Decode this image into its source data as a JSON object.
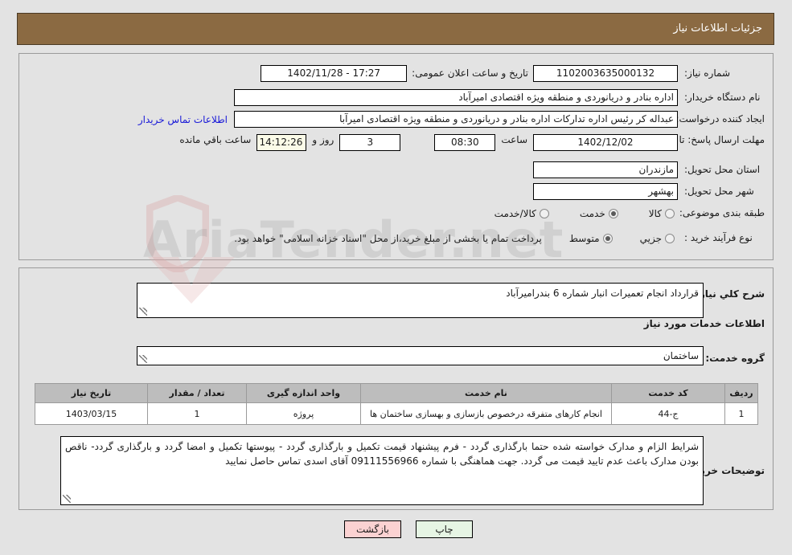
{
  "header": {
    "title": "جزئیات اطلاعات نیاز"
  },
  "top": {
    "need_number_label": "شماره نیاز:",
    "need_number_value": "1102003635000132",
    "announce_label": "تاریخ و ساعت اعلان عمومی:",
    "announce_value": "17:27 - 1402/11/28",
    "buyer_org_label": "نام دستگاه خریدار:",
    "buyer_org_value": "اداره بنادر و دریانوردی و منطقه ویژه اقتصادی امیرآباد",
    "requester_label": "ایجاد کننده درخواست:",
    "requester_value": "عبداله کر رئیس اداره تدارکات اداره بنادر و دریانوردی و منطقه ویژه اقتصادی امیرآبا",
    "contact_link": "اطلاعات تماس خریدار",
    "deadline_label": "مهلت ارسال پاسخ: تا تاریخ:",
    "deadline_date": "1402/12/02",
    "time_label": "ساعت",
    "deadline_time": "08:30",
    "days_value": "3",
    "days_label": "روز و",
    "countdown_value": "14:12:26",
    "countdown_label": "ساعت باقي مانده",
    "province_label": "استان محل تحویل:",
    "province_value": "مازندران",
    "city_label": "شهر محل تحویل:",
    "city_value": "بهشهر",
    "category_label": "طبقه بندی موضوعی:",
    "category_options": [
      {
        "label": "کالا",
        "selected": false
      },
      {
        "label": "خدمت",
        "selected": true
      },
      {
        "label": "کالا/خدمت",
        "selected": false
      }
    ],
    "process_label": "نوع فرآیند خرید :",
    "process_options": [
      {
        "label": "جزیي",
        "selected": false
      },
      {
        "label": "متوسط",
        "selected": true
      }
    ],
    "process_note": "پرداخت تمام یا بخشی از مبلغ خرید،از محل \"اسناد خزانه اسلامی\" خواهد بود."
  },
  "middle": {
    "general_desc_label": "شرح کلي نیاز:",
    "general_desc_value": "قرارداد انجام تعمیرات انبار شماره 6 بندرامیرآباد",
    "services_info_label": "اطلاعات خدمات مورد نیاز",
    "service_group_label": "گروه خدمت:",
    "service_group_value": "ساختمان",
    "buyer_notes_label": "توضیحات خریدار:",
    "buyer_notes_value": "شرایط الزام و مدارک خواسته شده حتما بارگذاری گردد - فرم پیشنهاد قیمت تکمیل و بارگذاری گردد - پیوستها تکمیل و امضا گردد و بارگذاری گردد- ناقص بودن مدارک باعث عدم تایید قیمت می گردد. جهت هماهنگی با شماره 09111556966 آقای اسدی تماس حاصل نمایید"
  },
  "table": {
    "columns": [
      "ردیف",
      "کد خدمت",
      "نام خدمت",
      "واحد اندازه گیری",
      "تعداد / مقدار",
      "تاریخ نیاز"
    ],
    "rows": [
      {
        "row_no": "1",
        "service_code": "ج-44",
        "service_name": "انجام کارهای متفرقه درخصوص بازسازی و بهسازی ساختمان ها",
        "unit": "پروژه",
        "quantity": "1",
        "need_date": "1403/03/15"
      }
    ]
  },
  "footer": {
    "back_label": "بازگشت",
    "print_label": "چاپ"
  },
  "watermark": {
    "text": "AriaTender.net",
    "shield_icon": "shield-icon",
    "arrow_icon": "arrow-down-icon"
  },
  "colors": {
    "header_bg": "#8b6a42",
    "page_bg": "#e3e3e3",
    "link": "#1818d8",
    "back_btn": "#fbd2d2",
    "print_btn": "#e6f5e4",
    "table_header": "#bdbdbd"
  }
}
